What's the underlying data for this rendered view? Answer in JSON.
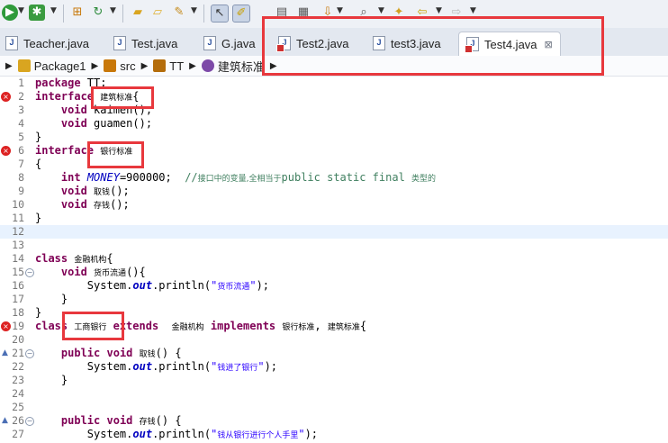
{
  "toolbar": {
    "icons": [
      "run-icon",
      "debug-icon",
      "new-java-project-icon",
      "refresh-icon",
      "open-folder-icon",
      "folder-icon",
      "edit-icon",
      "select-icon",
      "highlight-icon",
      "open-type-icon",
      "outline-icon",
      "next-annotation-icon",
      "search-icon",
      "back-icon",
      "forward-icon"
    ]
  },
  "tabs": [
    {
      "label": "Teacher.java",
      "error": false
    },
    {
      "label": "Test.java",
      "error": false
    },
    {
      "label": "G.java",
      "error": false
    },
    {
      "label": "Test2.java",
      "error": true
    },
    {
      "label": "test3.java",
      "error": false
    },
    {
      "label": "Test4.java",
      "error": true,
      "active": true,
      "close": "⊠"
    }
  ],
  "breadcrumb": {
    "items": [
      "Package1",
      "src",
      "TT",
      "建筑标准"
    ]
  },
  "editor": {
    "lines": [
      {
        "num": "1",
        "text": "package TT;"
      },
      {
        "num": "2",
        "text": "interface 建筑标准{"
      },
      {
        "num": "3",
        "text": "    void kaimen();"
      },
      {
        "num": "4",
        "text": "    void guamen();"
      },
      {
        "num": "5",
        "text": "}"
      },
      {
        "num": "6",
        "text": "interface 银行标准"
      },
      {
        "num": "7",
        "text": "{"
      },
      {
        "num": "8",
        "text": "    int MONEY=900000;  //接口中的变量,全相当于public static final 类型的"
      },
      {
        "num": "9",
        "text": "    void 取钱();"
      },
      {
        "num": "10",
        "text": "    void 存钱();"
      },
      {
        "num": "11",
        "text": "}"
      },
      {
        "num": "12",
        "text": ""
      },
      {
        "num": "13",
        "text": ""
      },
      {
        "num": "14",
        "text": "class 金融机构{"
      },
      {
        "num": "15",
        "text": "    void 货币流通(){"
      },
      {
        "num": "16",
        "text": "        System.out.println(\"货币流通\");"
      },
      {
        "num": "17",
        "text": "    }"
      },
      {
        "num": "18",
        "text": "}"
      },
      {
        "num": "19",
        "text": "class 工商银行 extends  金融机构 implements 银行标准, 建筑标准{"
      },
      {
        "num": "20",
        "text": ""
      },
      {
        "num": "21",
        "text": "    public void 取钱() {"
      },
      {
        "num": "22",
        "text": "        System.out.println(\"钱进了银行\");"
      },
      {
        "num": "23",
        "text": "    }"
      },
      {
        "num": "24",
        "text": ""
      },
      {
        "num": "25",
        "text": ""
      },
      {
        "num": "26",
        "text": "    public void 存钱() {"
      },
      {
        "num": "27",
        "text": "        System.out.println(\"钱从银行进行个人手里\");"
      }
    ]
  },
  "markers": {
    "error": "×",
    "override": "▲",
    "fold": "−"
  },
  "colors": {
    "keyword": "#7f0055",
    "field": "#0000c0",
    "string": "#2a00ff",
    "comment": "#3f7f5f",
    "annotation_box": "#e8383d",
    "current_line": "#e8f2fe"
  }
}
